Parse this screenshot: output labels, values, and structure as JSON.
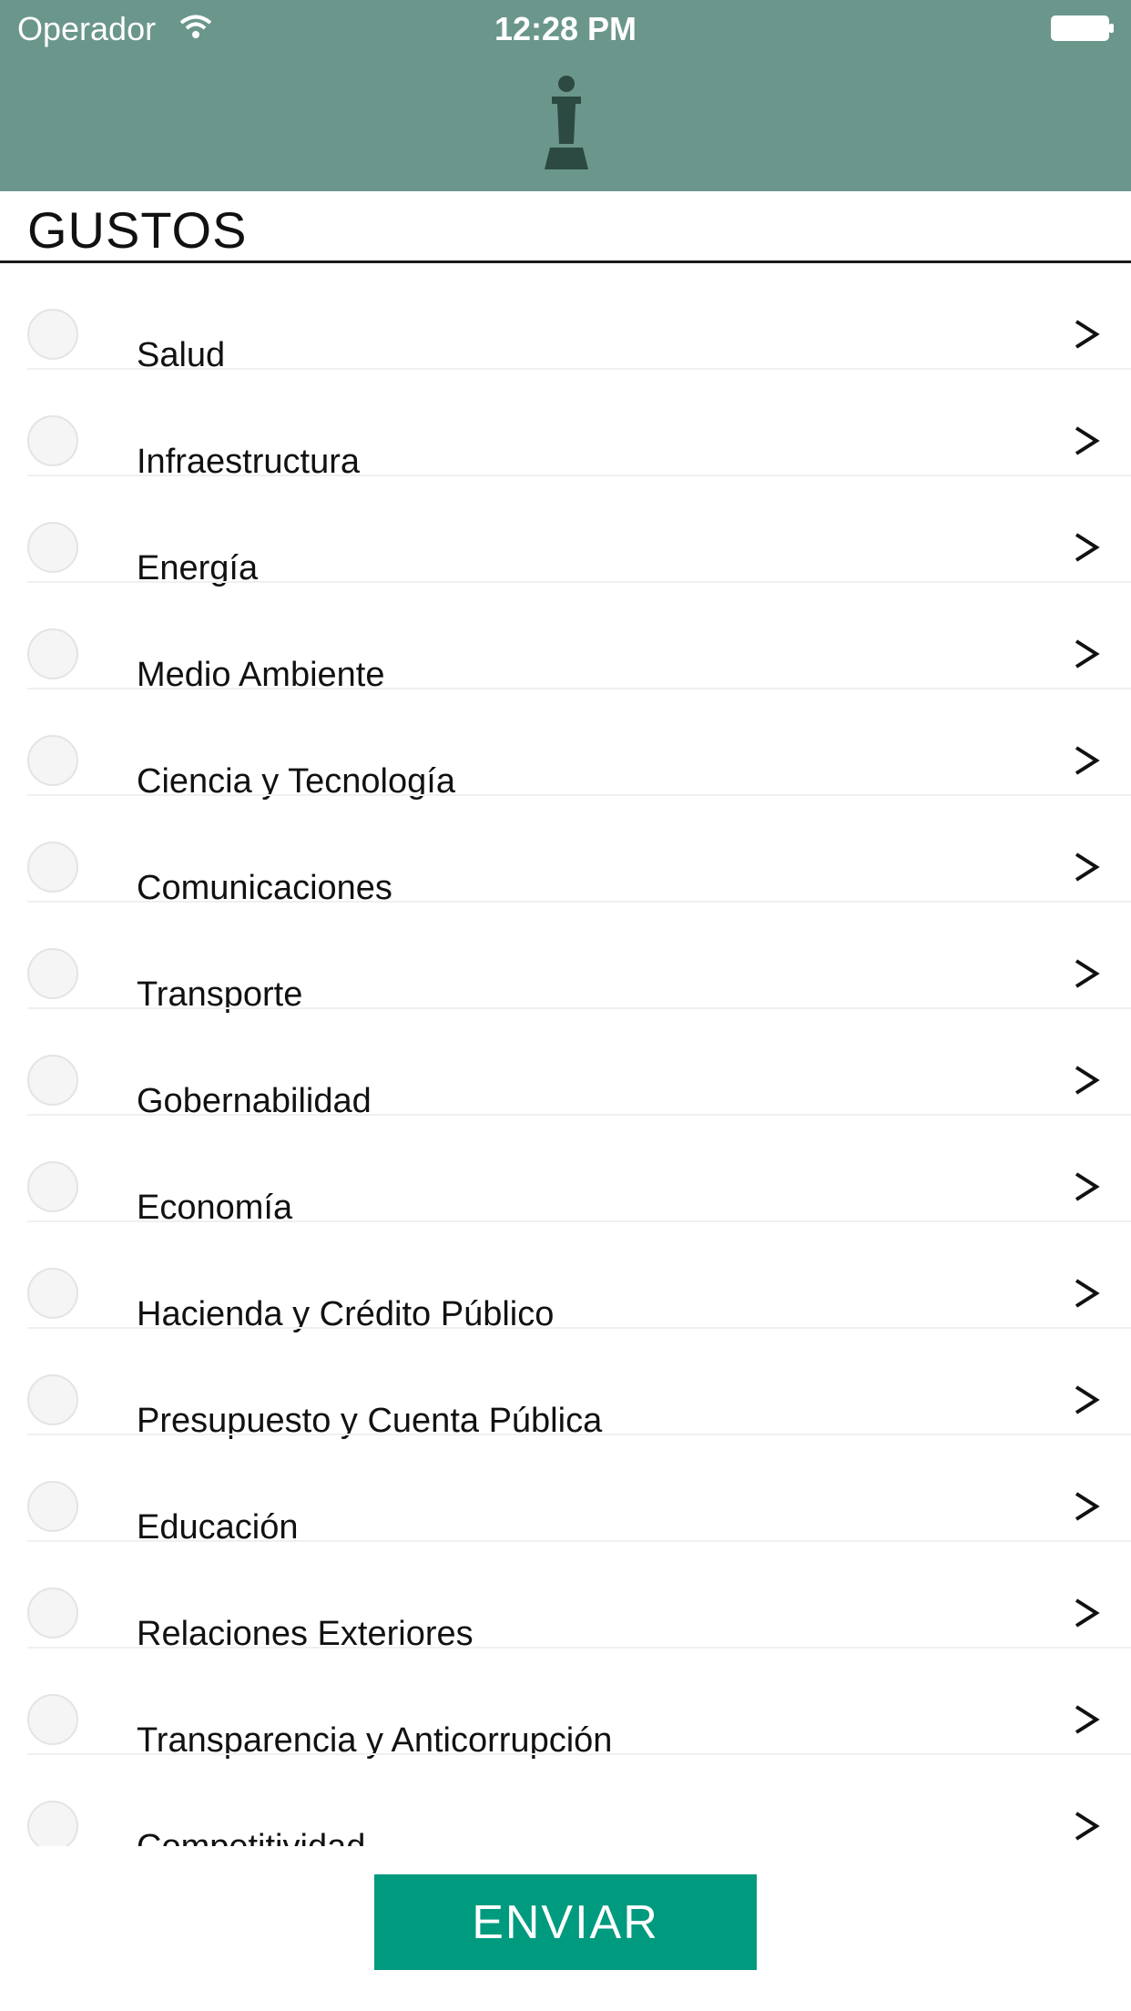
{
  "status_bar": {
    "carrier": "Operador",
    "time": "12:28 PM",
    "wifi_icon": "wifi-icon",
    "battery_icon": "battery-icon"
  },
  "nav": {
    "logo_icon": "info-chess-piece-icon",
    "bar_color": "#6b968c"
  },
  "header": {
    "title": "GUSTOS"
  },
  "items": [
    {
      "label": "Salud"
    },
    {
      "label": "Infraestructura"
    },
    {
      "label": "Energía"
    },
    {
      "label": "Medio Ambiente"
    },
    {
      "label": "Ciencia y Tecnología"
    },
    {
      "label": "Comunicaciones"
    },
    {
      "label": "Transporte"
    },
    {
      "label": "Gobernabilidad"
    },
    {
      "label": "Economía"
    },
    {
      "label": "Hacienda y Crédito Público"
    },
    {
      "label": "Presupuesto y Cuenta Pública"
    },
    {
      "label": "Educación"
    },
    {
      "label": "Relaciones Exteriores"
    },
    {
      "label": "Transparencia y Anticorrupción"
    },
    {
      "label": "Competitividad"
    }
  ],
  "actions": {
    "send_label": "ENVIAR",
    "button_color": "#009a7f"
  }
}
